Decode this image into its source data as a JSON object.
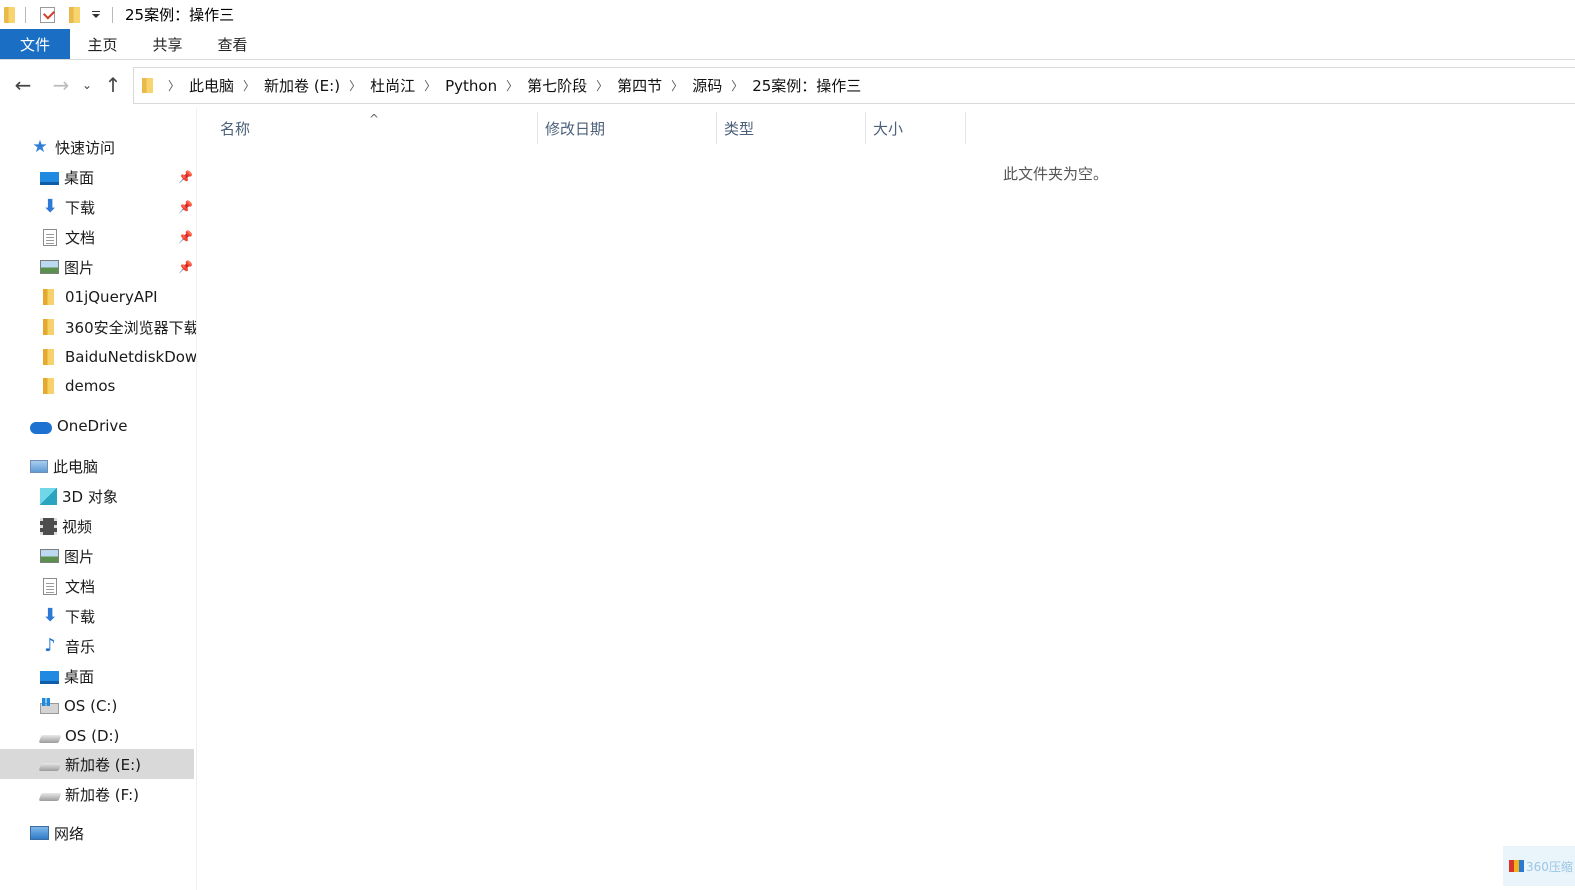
{
  "window": {
    "title": "25案例：操作三"
  },
  "ribbon": {
    "tabs": [
      "文件",
      "主页",
      "共享",
      "查看"
    ]
  },
  "address": {
    "breadcrumbs": [
      "此电脑",
      "新加卷 (E:)",
      "杜尚江",
      "Python",
      "第七阶段",
      "第四节",
      "源码",
      "25案例：操作三"
    ]
  },
  "nav_symbols": {
    "back": "←",
    "forward": "→",
    "recent": "⌄",
    "up": "↑",
    "sort": "^"
  },
  "sidebar": {
    "quick_access": "快速访问",
    "quick_items": [
      {
        "label": "桌面",
        "icon": "desktop-icon",
        "pinned": true
      },
      {
        "label": "下载",
        "icon": "download-icon",
        "pinned": true
      },
      {
        "label": "文档",
        "icon": "document-icon",
        "pinned": true
      },
      {
        "label": "图片",
        "icon": "picture-icon",
        "pinned": true
      },
      {
        "label": "01jQueryAPI",
        "icon": "folder-icon",
        "pinned": false
      },
      {
        "label": "360安全浏览器下载",
        "icon": "folder-icon",
        "pinned": false
      },
      {
        "label": "BaiduNetdiskDow",
        "icon": "folder-icon",
        "pinned": false
      },
      {
        "label": "demos",
        "icon": "folder-icon",
        "pinned": false
      }
    ],
    "onedrive": "OneDrive",
    "this_pc": "此电脑",
    "pc_items": [
      {
        "label": "3D 对象",
        "icon": "3d-objects-icon"
      },
      {
        "label": "视频",
        "icon": "video-icon"
      },
      {
        "label": "图片",
        "icon": "picture-icon"
      },
      {
        "label": "文档",
        "icon": "document-icon"
      },
      {
        "label": "下载",
        "icon": "download-icon"
      },
      {
        "label": "音乐",
        "icon": "music-icon"
      },
      {
        "label": "桌面",
        "icon": "desktop-icon"
      },
      {
        "label": "OS (C:)",
        "icon": "system-drive-icon"
      },
      {
        "label": "OS (D:)",
        "icon": "drive-icon"
      },
      {
        "label": "新加卷 (E:)",
        "icon": "drive-icon",
        "selected": true
      },
      {
        "label": "新加卷 (F:)",
        "icon": "drive-icon"
      }
    ],
    "network": "网络"
  },
  "columns": [
    "名称",
    "修改日期",
    "类型",
    "大小"
  ],
  "content": {
    "empty_message": "此文件夹为空。"
  },
  "tray": {
    "label": "360压缩"
  },
  "colors": {
    "accent": "#1a6fc4",
    "selected_bg": "#d9d9d9",
    "column_text": "#4c607a"
  }
}
